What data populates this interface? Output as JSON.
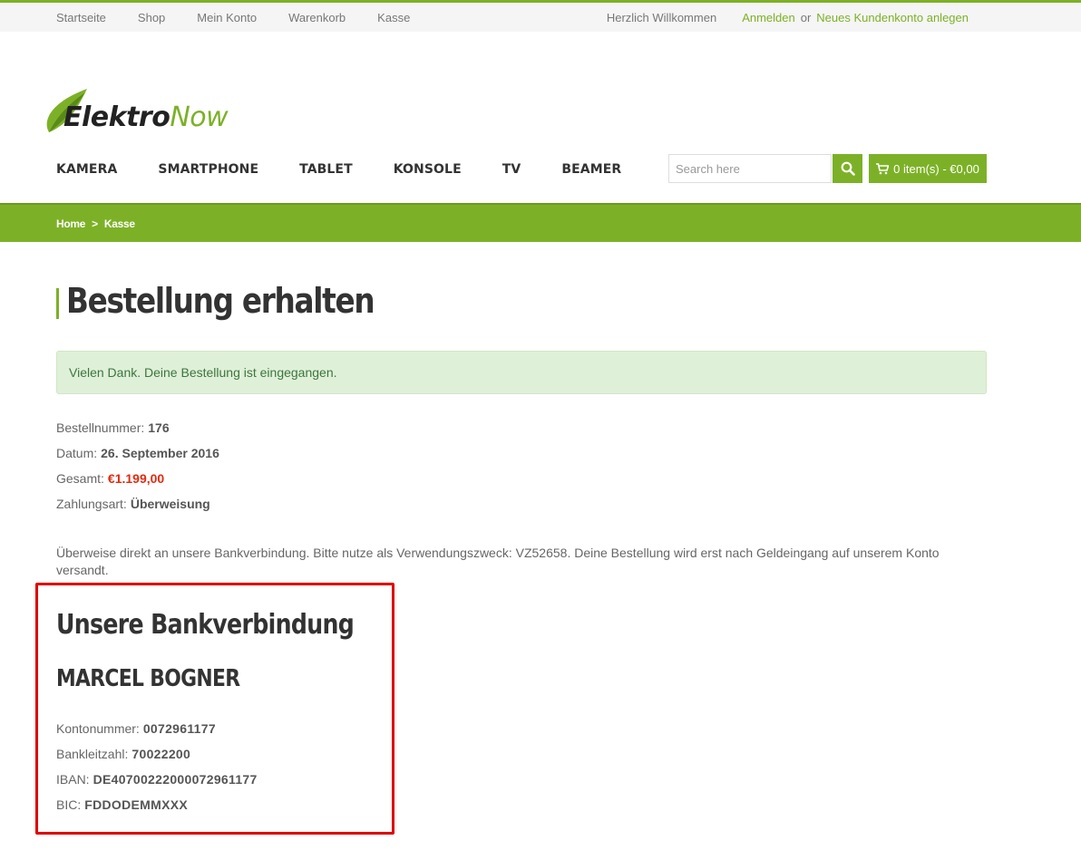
{
  "topbar": {
    "links": [
      "Startseite",
      "Shop",
      "Mein Konto",
      "Warenkorb",
      "Kasse"
    ],
    "welcome": "Herzlich Willkommen",
    "login": "Anmelden",
    "or": "or",
    "register": "Neues Kundenkonto anlegen"
  },
  "logo": {
    "part1": "Elektro",
    "part2": "Now"
  },
  "nav": [
    "KAMERA",
    "SMARTPHONE",
    "TABLET",
    "KONSOLE",
    "TV",
    "BEAMER"
  ],
  "search": {
    "placeholder": "Search here"
  },
  "cart": {
    "label": "0 item(s) - €0,00"
  },
  "breadcrumb": {
    "home": "Home",
    "sep": ">",
    "current": "Kasse"
  },
  "page": {
    "title": "Bestellung erhalten",
    "notice": "Vielen Dank. Deine Bestellung ist eingegangen."
  },
  "order": {
    "number_label": "Bestellnummer:",
    "number": "176",
    "date_label": "Datum:",
    "date": "26. September 2016",
    "total_label": "Gesamt:",
    "total": "€1.199,00",
    "payment_label": "Zahlungsart:",
    "payment": "Überweisung"
  },
  "instruction": "Überweise direkt an unsere Bankverbindung. Bitte nutze als Verwendungszweck: VZ52658. Deine Bestellung wird erst nach Geldeingang auf unserem Konto versandt.",
  "bank": {
    "heading": "Unsere Bankverbindung",
    "holder": "MARCEL BOGNER",
    "account_label": "Kontonummer:",
    "account": "0072961177",
    "blz_label": "Bankleitzahl:",
    "blz": "70022200",
    "iban_label": "IBAN:",
    "iban": "DE40700222000072961177",
    "bic_label": "BIC:",
    "bic": "FDDODEMMXXX"
  },
  "colors": {
    "accent": "#7cb127",
    "price": "#e02b0e",
    "highlight_border": "#e00000",
    "notice_bg": "#dff0d8"
  }
}
